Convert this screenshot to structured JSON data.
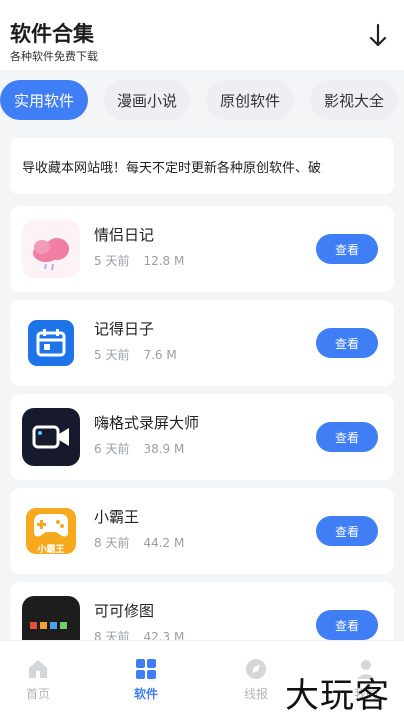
{
  "header": {
    "title": "软件合集",
    "subtitle": "各种软件免费下载",
    "download_icon": "download-arrow-icon"
  },
  "tabs": [
    {
      "label": "实用软件",
      "active": true
    },
    {
      "label": "漫画小说",
      "active": false
    },
    {
      "label": "原创软件",
      "active": false
    },
    {
      "label": "影视大全",
      "active": false
    }
  ],
  "notice": {
    "text": "导收藏本网站哦！每天不定时更新各种原创软件、破"
  },
  "apps": [
    {
      "name": "情侣日记",
      "age": "5 天前",
      "size": "12.8 M",
      "button": "查看",
      "icon": "cloud-heart-icon"
    },
    {
      "name": "记得日子",
      "age": "5 天前",
      "size": "7.6 M",
      "button": "查看",
      "icon": "calendar-icon"
    },
    {
      "name": "嗨格式录屏大师",
      "age": "6 天前",
      "size": "38.9 M",
      "button": "查看",
      "icon": "video-camera-icon"
    },
    {
      "name": "小霸王",
      "age": "8 天前",
      "size": "44.2 M",
      "button": "查看",
      "icon": "gamepad-icon",
      "icon_text": "小霸王"
    },
    {
      "name": "可可修图",
      "age": "8 天前",
      "size": "42.3 M",
      "button": "查看",
      "icon": "photo-palette-icon"
    }
  ],
  "bottom_nav": [
    {
      "label": "首页",
      "icon": "home-icon",
      "active": false
    },
    {
      "label": "软件",
      "icon": "grid-icon",
      "active": true
    },
    {
      "label": "线报",
      "icon": "compass-icon",
      "active": false
    },
    {
      "label": "我的",
      "icon": "user-icon",
      "active": false
    }
  ],
  "watermark": "大玩客",
  "colors": {
    "accent": "#3f7ef4",
    "background": "#f4f5f7",
    "inactive_tab": "#eeeff2"
  }
}
